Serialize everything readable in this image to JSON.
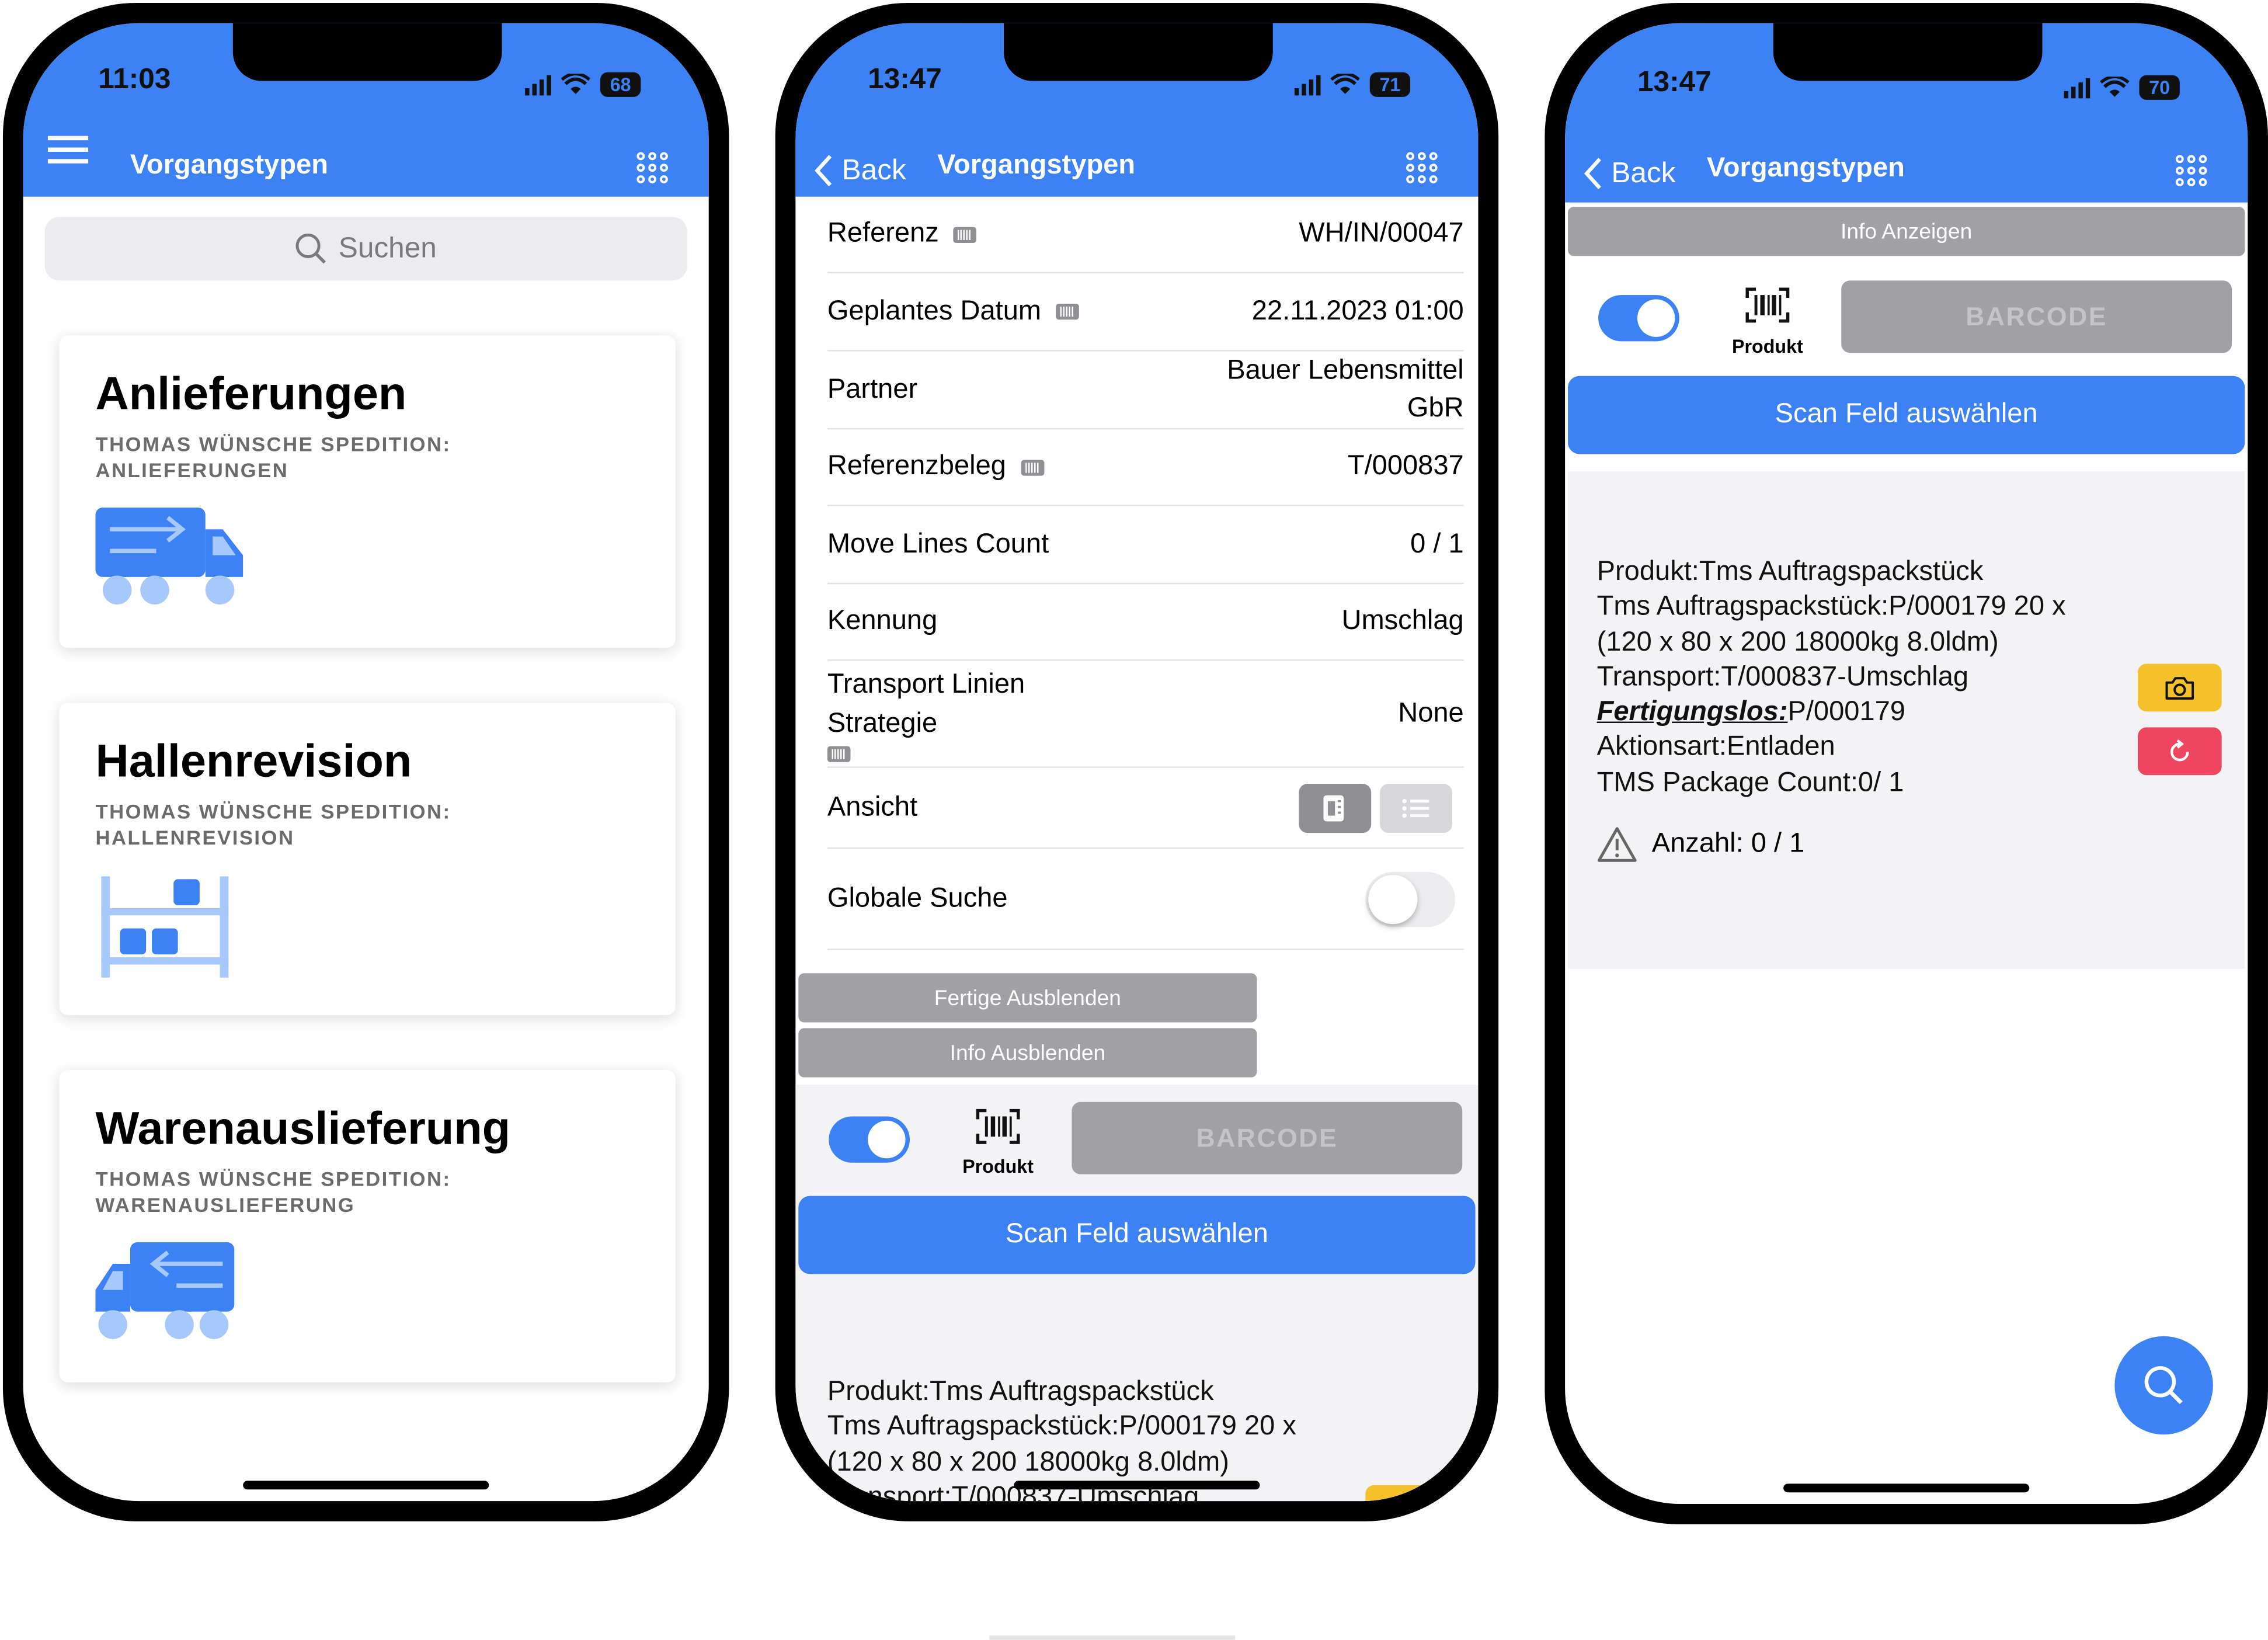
{
  "phones": [
    {
      "time": "11:03",
      "battery": "68",
      "nav_title": "Vorgangstypen",
      "search": {
        "placeholder": "Suchen"
      },
      "cards": [
        {
          "title": "Anlieferungen",
          "subtitle": "THOMAS WÜNSCHE SPEDITION: ANLIEFERUNGEN",
          "icon": "delivery-truck-icon"
        },
        {
          "title": "Hallenrevision",
          "subtitle": "THOMAS WÜNSCHE SPEDITION: HALLENREVISION",
          "icon": "warehouse-shelf-icon"
        },
        {
          "title": "Warenauslieferung",
          "subtitle": "THOMAS WÜNSCHE SPEDITION: WARENAUSLIEFERUNG",
          "icon": "outgoing-truck-icon"
        }
      ]
    },
    {
      "time": "13:47",
      "battery": "71",
      "back_label": "Back",
      "nav_title": "Vorgangstypen",
      "details": [
        {
          "label": "Referenz",
          "value": "WH/IN/00047"
        },
        {
          "label": "Geplantes Datum",
          "value": "22.11.2023 01:00"
        },
        {
          "label": "Partner",
          "value": "Bauer Lebensmittel GbR"
        },
        {
          "label": "Referenzbeleg",
          "value": "T/000837"
        },
        {
          "label": "Move Lines Count",
          "value": "0 / 1"
        },
        {
          "label": "Kennung",
          "value": "Umschlag"
        },
        {
          "label": "Transport Linien Strategie",
          "value": "None"
        },
        {
          "label": "Ansicht"
        },
        {
          "label": "Globale Suche"
        }
      ],
      "buttons": {
        "hide_done": "Fertige Ausblenden",
        "hide_info": "Info Ausblenden"
      },
      "scan": {
        "mode_label": "Produkt",
        "barcode_placeholder": "BARCODE",
        "select_field": "Scan Feld auswählen"
      },
      "info_lines": [
        "Produkt:Tms Auftragspackstück",
        "Tms Auftragspackstück:P/000179 20 x",
        "(120 x 80 x 200 18000kg 8.0ldm)",
        "Transport:T/000837-Umschlag"
      ]
    },
    {
      "time": "13:47",
      "battery": "70",
      "back_label": "Back",
      "nav_title": "Vorgangstypen",
      "buttons": {
        "show_info": "Info Anzeigen"
      },
      "scan": {
        "mode_label": "Produkt",
        "barcode_placeholder": "BARCODE",
        "select_field": "Scan Feld auswählen"
      },
      "info": {
        "line1": "Produkt:Tms Auftragspackstück",
        "line2": "Tms Auftragspackstück:P/000179 20 x",
        "line3": "(120 x 80 x 200 18000kg 8.0ldm)",
        "line4": "Transport:T/000837-Umschlag",
        "lot_label": "Fertigungslos:",
        "lot_value": "P/000179",
        "line6": "Aktionsart:Entladen",
        "line7": "TMS Package Count:0/ 1",
        "quantity": "Anzahl: 0 / 1"
      }
    }
  ],
  "colors": {
    "primary": "#3c82f5",
    "button_gray": "#a1a1a5",
    "warning": "#f5c12a",
    "danger": "#ee4660",
    "illustration_light": "#a7c8fb"
  }
}
